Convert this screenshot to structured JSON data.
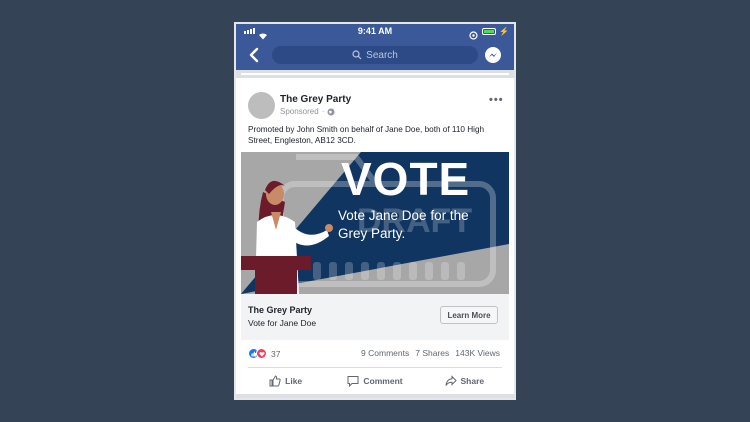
{
  "status_bar": {
    "time": "9:41 AM"
  },
  "nav": {
    "search_placeholder": "Search"
  },
  "post": {
    "page_name": "The Grey Party",
    "sponsored": "Sponsored",
    "promoted_text": "Promoted by John Smith on behalf of Jane Doe, both of 110 High Street, Engleston, AB12 3CD.",
    "creative": {
      "headline": "VOTE",
      "subtext": "Vote Jane Doe for the Grey Party.",
      "watermark": "DRAFT",
      "colors": {
        "navy": "#0f3560",
        "grey": "#a7a7a7",
        "maroon": "#6b1b2a"
      }
    },
    "link_bar": {
      "title": "The Grey Party",
      "subtitle": "Vote for Jane Doe",
      "cta": "Learn More"
    },
    "stats": {
      "reaction_count": "37",
      "comments": "9 Comments",
      "shares": "7 Shares",
      "views": "143K Views"
    },
    "actions": {
      "like": "Like",
      "comment": "Comment",
      "share": "Share"
    }
  },
  "colors": {
    "background": "#344356",
    "facebook_blue": "#3b5998"
  }
}
